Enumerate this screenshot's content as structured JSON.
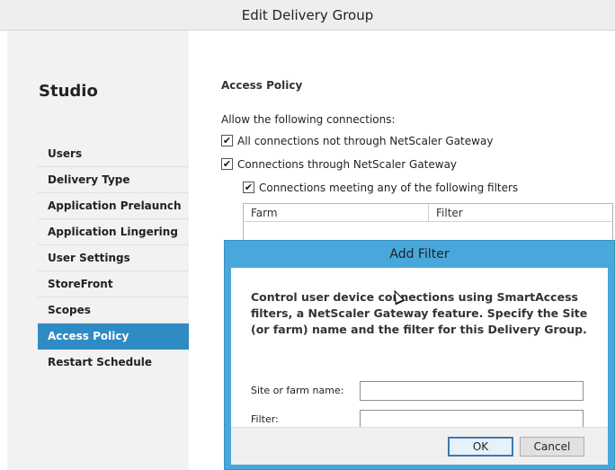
{
  "window": {
    "title": "Edit Delivery Group"
  },
  "sidebar": {
    "brand": "Studio",
    "items": [
      {
        "label": "Users"
      },
      {
        "label": "Delivery Type"
      },
      {
        "label": "Application Prelaunch"
      },
      {
        "label": "Application Lingering"
      },
      {
        "label": "User Settings"
      },
      {
        "label": "StoreFront"
      },
      {
        "label": "Scopes"
      },
      {
        "label": "Access Policy",
        "active": true
      },
      {
        "label": "Restart Schedule"
      }
    ]
  },
  "main": {
    "section_title": "Access Policy",
    "allow_label": "Allow the following connections:",
    "options": [
      {
        "label": "All connections not through NetScaler Gateway",
        "checked": true
      },
      {
        "label": "Connections through NetScaler Gateway",
        "checked": true
      },
      {
        "label": "Connections meeting any of the following filters",
        "checked": true
      }
    ],
    "table": {
      "columns": [
        "Farm",
        "Filter"
      ]
    }
  },
  "dialog": {
    "title": "Add Filter",
    "description": "Control user device connections using SmartAccess filters, a NetScaler Gateway feature. Specify the Site (or farm) name and the filter for this Delivery Group.",
    "site_label": "Site or farm name:",
    "site_value": "",
    "filter_label": "Filter:",
    "filter_value": "",
    "ok_label": "OK",
    "cancel_label": "Cancel"
  },
  "colors": {
    "accent": "#2f8bc3",
    "dialog_frame": "#48a8dc"
  }
}
